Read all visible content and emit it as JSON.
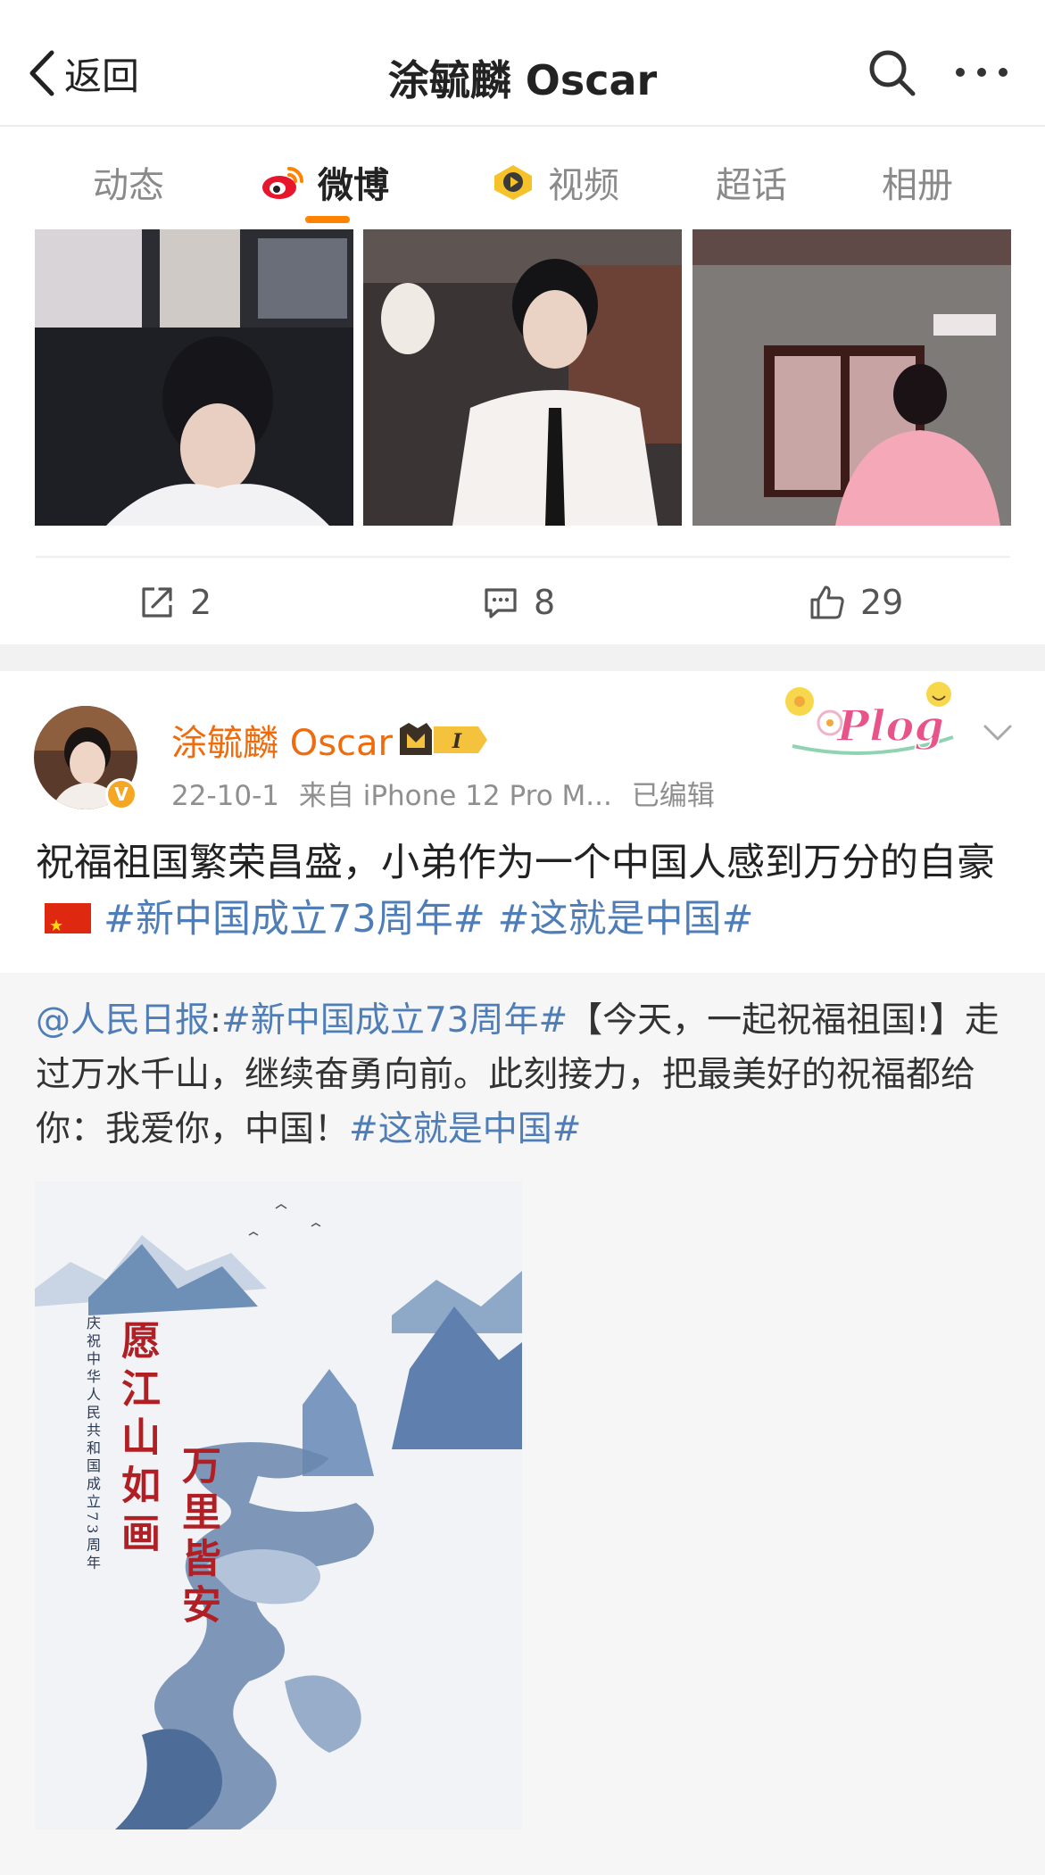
{
  "nav": {
    "back_label": "返回",
    "title": "涂毓麟 Oscar"
  },
  "tabs": [
    {
      "label": "动态",
      "active": false
    },
    {
      "label": "微博",
      "active": true
    },
    {
      "label": "视频",
      "active": false
    },
    {
      "label": "超话",
      "active": false
    },
    {
      "label": "相册",
      "active": false
    }
  ],
  "post1": {
    "reposts": "2",
    "comments": "8",
    "likes": "29"
  },
  "post2": {
    "author": "涂毓麟 Oscar",
    "vip_level": "I",
    "verified_badge": "V",
    "date": "22-10-1",
    "source": "来自 iPhone 12 Pro M...",
    "edited": "已编辑",
    "body_text": "祝福祖国繁荣昌盛，小弟作为一个中国人感到万分的自豪",
    "hashtags": [
      "#新中国成立73周年#",
      "#这就是中国#"
    ],
    "sticker_text": "Plog",
    "repost": {
      "mention": "@人民日报",
      "colon": ":",
      "hashtag1": "#新中国成立73周年#",
      "text": "【今天，一起祝福祖国!】走过万水千山，继续奋勇向前。此刻接力，把最美好的祝福都给你：我爱你，中国！",
      "hashtag2": "#这就是中国#",
      "poster": {
        "small_text": "庆祝中华人民共和国成立73周年",
        "line1": "愿江山如画",
        "line2": "万里皆安"
      }
    }
  },
  "colors": {
    "accent": "#ff8200",
    "username": "#f06b0b",
    "link": "#4f7db7",
    "muted": "#8f8f8f"
  }
}
